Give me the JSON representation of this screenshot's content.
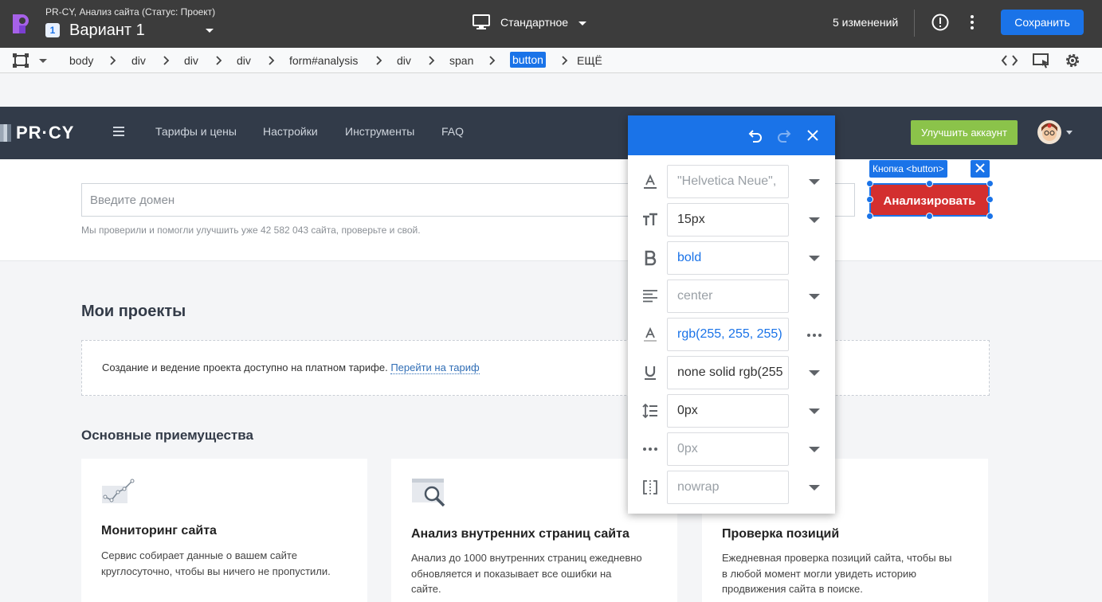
{
  "app": {
    "subtitle": "PR-CY, Анализ сайта (Статус: Проект)",
    "variant_number": "1",
    "variant_name": "Вариант 1",
    "device_label": "Стандартное",
    "changes_label": "5 изменений",
    "save_label": "Сохранить",
    "accent_color": "#1a73e8"
  },
  "breadcrumb": [
    "body",
    "div",
    "div",
    "div",
    "form#analysis",
    "div",
    "span",
    "button",
    "ЕЩЁ"
  ],
  "site": {
    "logo_text": "PR·CY",
    "nav": [
      "Тарифы и цены",
      "Настройки",
      "Инструменты",
      "FAQ"
    ],
    "upgrade_label": "Улучшить аккаунт",
    "domain_placeholder": "Введите домен",
    "search_hint": "Мы проверили и помогли улучшить уже 42 582 043 сайта, проверьте и свой.",
    "analyze_label": "Анализировать",
    "selected_tag": "Кнопка <button>",
    "projects_title": "Мои проекты",
    "projects_text": "Создание и ведение проекта доступно на платном тарифе.",
    "projects_link": "Перейти на тариф",
    "advantages_title": "Основные приемущества",
    "cards": [
      {
        "title": "Мониторинг сайта",
        "text": "Сервис собирает данные о вашем сайте круглосуточно, чтобы вы ничего не пропустили."
      },
      {
        "title": "Анализ внутренних страниц сайта",
        "text": "Анализ до 1000 внутренних страниц ежедневно обновляется и показывает все ошибки на сайте."
      },
      {
        "title": "Проверка позиций",
        "text": "Ежедневная проверка позиций сайта, чтобы вы в любой момент могли увидеть историю продвижения сайта в поиске."
      }
    ]
  },
  "style_panel": {
    "font_family": "\"Helvetica Neue\",",
    "font_size": "15px",
    "font_weight": "bold",
    "text_align": "center",
    "color": "rgb(255, 255, 255)",
    "text_decoration": "none solid rgb(255",
    "line_height": "0px",
    "letter_spacing": "0px",
    "white_space": "nowrap"
  }
}
